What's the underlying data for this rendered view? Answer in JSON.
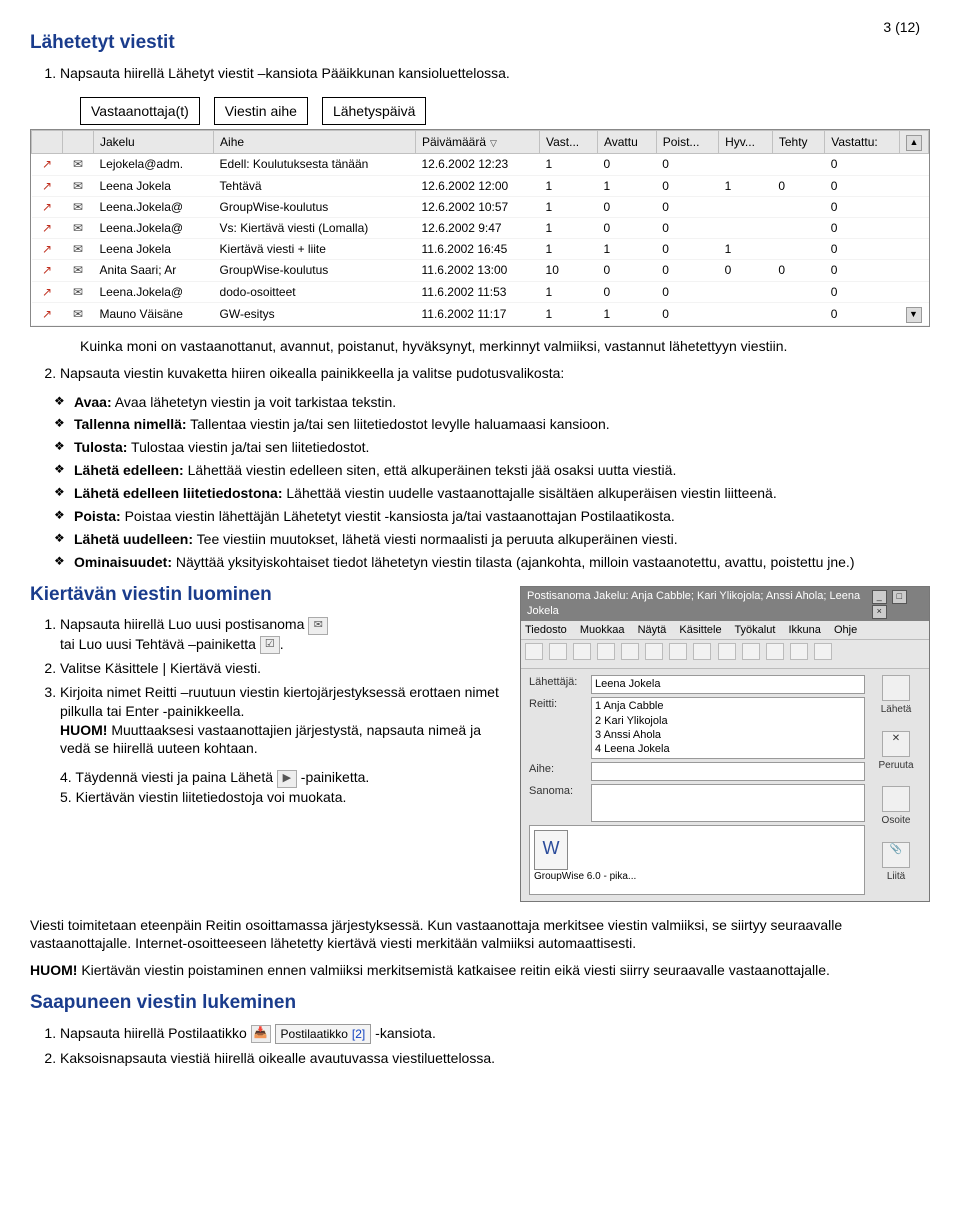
{
  "page_number": "3 (12)",
  "sections": {
    "sent": {
      "title": "Lähetetyt viestit",
      "step1": "Napsauta hiirellä Lähetyt viestit –kansiota Pääikkunan kansioluettelossa.",
      "labels": {
        "recipients": "Vastaanottaja(t)",
        "subject": "Viestin aihe",
        "sent_date": "Lähetyspäivä"
      },
      "between_text": "Kuinka moni on vastaanottanut, avannut, poistanut, hyväksynyt, merkinnyt valmiiksi, vastannut lähetettyyn viestiin.",
      "step2": "Napsauta viestin kuvaketta hiiren oikealla painikkeella ja valitse pudotusvalikosta:",
      "grid": {
        "headers": [
          "Jakelu",
          "Aihe",
          "Päivämäärä",
          "Vast...",
          "Avattu",
          "Poist...",
          "Hyv...",
          "Tehty",
          "Vastattu:"
        ],
        "rows": [
          {
            "jakelu": "Lejokela@adm.",
            "aihe": "Edell: Koulutuksesta tänään",
            "pvm": "12.6.2002 12:23",
            "v": "1",
            "a": "0",
            "p": "0",
            "h": "",
            "t": "",
            "vs": "0"
          },
          {
            "jakelu": "Leena Jokela",
            "aihe": "Tehtävä",
            "pvm": "12.6.2002 12:00",
            "v": "1",
            "a": "1",
            "p": "0",
            "h": "1",
            "t": "0",
            "vs": "0"
          },
          {
            "jakelu": "Leena.Jokela@",
            "aihe": "GroupWise-koulutus",
            "pvm": "12.6.2002 10:57",
            "v": "1",
            "a": "0",
            "p": "0",
            "h": "",
            "t": "",
            "vs": "0"
          },
          {
            "jakelu": "Leena.Jokela@",
            "aihe": "Vs: Kiertävä viesti (Lomalla)",
            "pvm": "12.6.2002 9:47",
            "v": "1",
            "a": "0",
            "p": "0",
            "h": "",
            "t": "",
            "vs": "0"
          },
          {
            "jakelu": "Leena Jokela",
            "aihe": "Kiertävä viesti + liite",
            "pvm": "11.6.2002 16:45",
            "v": "1",
            "a": "1",
            "p": "0",
            "h": "1",
            "t": "",
            "vs": "0"
          },
          {
            "jakelu": "Anita Saari; Ar",
            "aihe": "GroupWise-koulutus",
            "pvm": "11.6.2002 13:00",
            "v": "10",
            "a": "0",
            "p": "0",
            "h": "0",
            "t": "0",
            "vs": "0"
          },
          {
            "jakelu": "Leena.Jokela@",
            "aihe": "dodo-osoitteet",
            "pvm": "11.6.2002 11:53",
            "v": "1",
            "a": "0",
            "p": "0",
            "h": "",
            "t": "",
            "vs": "0"
          },
          {
            "jakelu": "Mauno Väisäne",
            "aihe": "GW-esitys",
            "pvm": "11.6.2002 11:17",
            "v": "1",
            "a": "1",
            "p": "0",
            "h": "",
            "t": "",
            "vs": "0"
          }
        ]
      },
      "bullets": [
        {
          "b": "Avaa:",
          "t": " Avaa lähetetyn viestin ja voit tarkistaa tekstin."
        },
        {
          "b": "Tallenna nimellä:",
          "t": " Tallentaa viestin ja/tai sen liitetiedostot levylle haluamaasi kansioon."
        },
        {
          "b": "Tulosta:",
          "t": " Tulostaa viestin ja/tai sen liitetiedostot."
        },
        {
          "b": "Lähetä edelleen:",
          "t": " Lähettää viestin edelleen siten, että alkuperäinen teksti jää osaksi uutta viestiä."
        },
        {
          "b": "Lähetä edelleen liitetiedostona:",
          "t": " Lähettää viestin uudelle vastaanottajalle sisältäen alkuperäisen viestin liitteenä."
        },
        {
          "b": "Poista:",
          "t": " Poistaa viestin lähettäjän Lähetetyt viestit -kansiosta ja/tai vastaanottajan Postilaatikosta."
        },
        {
          "b": "Lähetä uudelleen:",
          "t": " Tee viestiin muutokset, lähetä viesti normaalisti ja peruuta alkuperäinen viesti."
        },
        {
          "b": "Ominaisuudet:",
          "t": " Näyttää yksityiskohtaiset tiedot lähetetyn viestin tilasta (ajankohta, milloin vastaanotettu, avattu, poistettu jne.)"
        }
      ]
    },
    "rotating": {
      "title": "Kiertävän viestin luominen",
      "step1a": "Napsauta hiirellä Luo uusi postisanoma",
      "step1b": "tai Luo uusi Tehtävä –painiketta",
      "step1c": ".",
      "step2": "Valitse Käsittele | Kiertävä viesti.",
      "step3a": "Kirjoita nimet Reitti –ruutuun viestin kiertojärjestyksessä erottaen nimet pilkulla tai Enter -painikkeella.",
      "step3b": "HUOM!",
      "step3c": " Muuttaaksesi vastaanottajien järjestystä, napsauta nimeä ja vedä se hiirellä uuteen kohtaan.",
      "step4a": "4. Täydennä viesti ja paina Lähetä ",
      "step4b": " -painiketta.",
      "step5": "5. Kiertävän viestin liitetiedostoja voi muokata.",
      "para1": "Viesti toimitetaan eteenpäin Reitin osoittamassa järjestyksessä. Kun vastaanottaja merkitsee viestin valmiiksi, se siirtyy seuraavalle vastaanottajalle. Internet-osoitteeseen lähetetty kiertävä viesti merkitään valmiiksi automaattisesti.",
      "para2a": "HUOM!",
      "para2b": " Kiertävän viestin poistaminen ennen valmiiksi merkitsemistä katkaisee reitin eikä viesti siirry seuraavalle vastaanottajalle."
    },
    "reading": {
      "title": "Saapuneen viestin lukeminen",
      "step1a": "Napsauta hiirellä Postilaatikko ",
      "step1b": " -kansiota.",
      "step2": "Kaksoisnapsauta viestiä hiirellä oikealle avautuvassa viestiluettelossa.",
      "mailbox_label": "Postilaatikko",
      "mailbox_count": "[2]"
    },
    "compose": {
      "title": "Postisanoma Jakelu: Anja Cabble; Kari Ylikojola; Anssi Ahola; Leena Jokela",
      "menu": [
        "Tiedosto",
        "Muokkaa",
        "Näytä",
        "Käsittele",
        "Työkalut",
        "Ikkuna",
        "Ohje"
      ],
      "labels": {
        "from": "Lähettäjä:",
        "route": "Reitti:",
        "subject": "Aihe:",
        "message": "Sanoma:"
      },
      "from_value": "Leena Jokela",
      "route_lines": [
        "1 Anja Cabble",
        "2 Kari Ylikojola",
        "3 Anssi Ahola",
        "4 Leena Jokela"
      ],
      "attach_name": "GroupWise 6.0 - pika...",
      "buttons": {
        "send": "Lähetä",
        "cancel": "Peruuta",
        "address": "Osoite",
        "attach": "Liitä"
      }
    }
  }
}
